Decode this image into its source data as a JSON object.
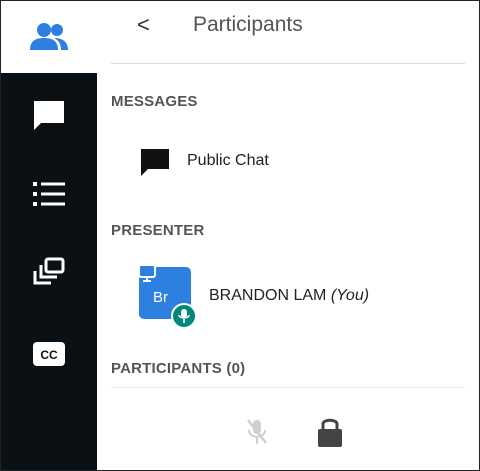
{
  "sidebar_rail": {
    "items": [
      {
        "icon": "participants-icon",
        "active": true
      },
      {
        "icon": "chat-icon",
        "active": false
      },
      {
        "icon": "notes-list-icon",
        "active": false
      },
      {
        "icon": "breakout-rooms-icon",
        "active": false
      },
      {
        "icon": "closed-captions-icon",
        "active": false
      }
    ],
    "active_bg": "#ffffff",
    "bg": "#0b1014",
    "accent": "#2d7fe0"
  },
  "header": {
    "back": "<",
    "title": "Participants"
  },
  "sections": {
    "messages": "MESSAGES",
    "presenter": "PRESENTER",
    "participants": "PARTICIPANTS (0)"
  },
  "messages": {
    "public_chat_label": "Public Chat"
  },
  "presenter": {
    "initials": "Br",
    "name": "BRANDON LAM",
    "you_label": "(You)",
    "avatar_color": "#2d7fe0",
    "mic_badge_color": "#00897b"
  },
  "footer": {
    "icons": [
      "mic-muted-icon",
      "lock-icon"
    ]
  }
}
